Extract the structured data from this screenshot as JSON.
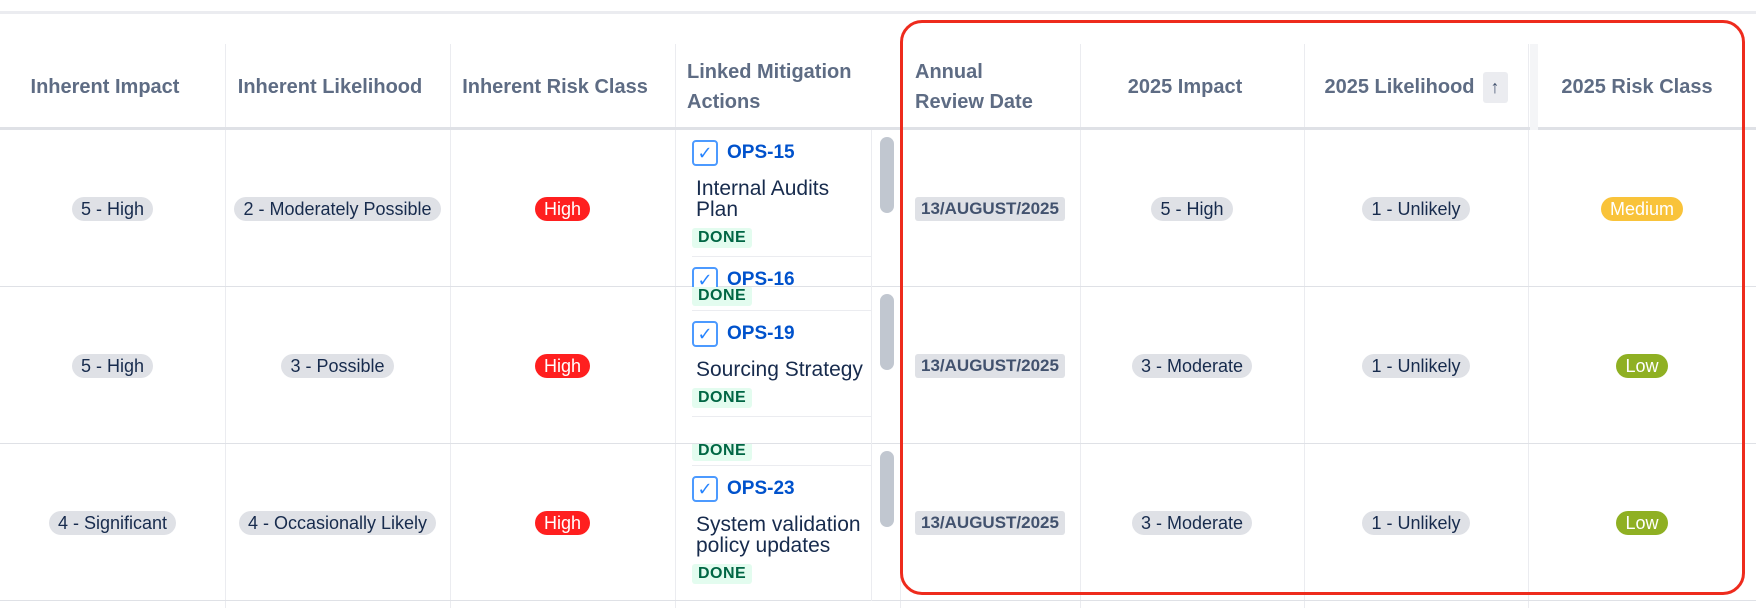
{
  "headers": {
    "inherent_impact": "Inherent Impact",
    "inherent_likelihood": "Inherent Likelihood",
    "inherent_risk_class": "Inherent Risk Class",
    "linked_mitigation_line1": "Linked Mitigation",
    "linked_mitigation_line2": "Actions",
    "annual_review_line1": "Annual",
    "annual_review_line2": "Review Date",
    "impact_2025": "2025 Impact",
    "likelihood_2025": "2025 Likelihood",
    "risk_class_2025": "2025 Risk Class",
    "sort_icon_glyph": "↑"
  },
  "rows": [
    {
      "inherent_impact": "5 - High",
      "inherent_likelihood": "2 - Moderately Possible",
      "inherent_risk_class": "High",
      "review_date": "13/AUGUST/2025",
      "impact_2025": "5 - High",
      "likelihood_2025": "1 - Unlikely",
      "risk_class_2025": "Medium",
      "mitigations": [
        {
          "key": "OPS-15",
          "summary": "Internal Audits Plan",
          "status": "DONE"
        },
        {
          "key": "OPS-16",
          "summary": "",
          "status": ""
        }
      ]
    },
    {
      "inherent_impact": "5 - High",
      "inherent_likelihood": "3 - Possible",
      "inherent_risk_class": "High",
      "review_date": "13/AUGUST/2025",
      "impact_2025": "3 - Moderate",
      "likelihood_2025": "1 - Unlikely",
      "risk_class_2025": "Low",
      "top_partial_status": "DONE",
      "mitigations": [
        {
          "key": "OPS-19",
          "summary": "Sourcing Strategy",
          "status": "DONE"
        }
      ]
    },
    {
      "inherent_impact": "4 - Significant",
      "inherent_likelihood": "4 - Occasionally Likely",
      "inherent_risk_class": "High",
      "review_date": "13/AUGUST/2025",
      "impact_2025": "3 - Moderate",
      "likelihood_2025": "1 - Unlikely",
      "risk_class_2025": "Low",
      "top_partial_status": "DONE",
      "mitigations": [
        {
          "key": "OPS-23",
          "summary": "System validation policy updates",
          "status": "DONE"
        }
      ]
    }
  ],
  "colors": {
    "highlight": "#ee2b1d",
    "risk_high": "#ff1f1f",
    "risk_medium": "#f9c33a",
    "risk_low": "#8fb023",
    "link": "#0052cc"
  }
}
